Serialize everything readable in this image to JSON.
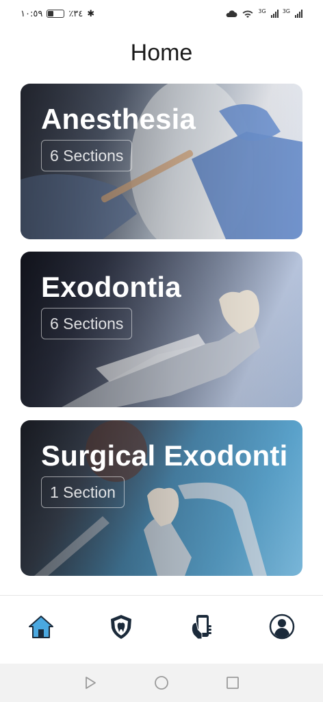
{
  "status_bar": {
    "time": "١٠:٥٩",
    "battery_text": "٪٣٤",
    "battery_level": 0.34,
    "network_labels": [
      "3G",
      "3G"
    ]
  },
  "header": {
    "title": "Home"
  },
  "cards": [
    {
      "title": "Anesthesia",
      "sections": "6 Sections"
    },
    {
      "title": "Exodontia",
      "sections": "6 Sections"
    },
    {
      "title": "Surgical Exodonti",
      "sections": "1 Section"
    }
  ],
  "bottom_nav": {
    "items": [
      {
        "icon": "home-icon",
        "active": true
      },
      {
        "icon": "tooth-shield-icon",
        "active": false
      },
      {
        "icon": "phone-hand-icon",
        "active": false
      },
      {
        "icon": "profile-icon",
        "active": false
      }
    ],
    "active_color": "#4aa8e0"
  },
  "system_nav": [
    "back-icon",
    "home-circle-icon",
    "recents-icon"
  ]
}
